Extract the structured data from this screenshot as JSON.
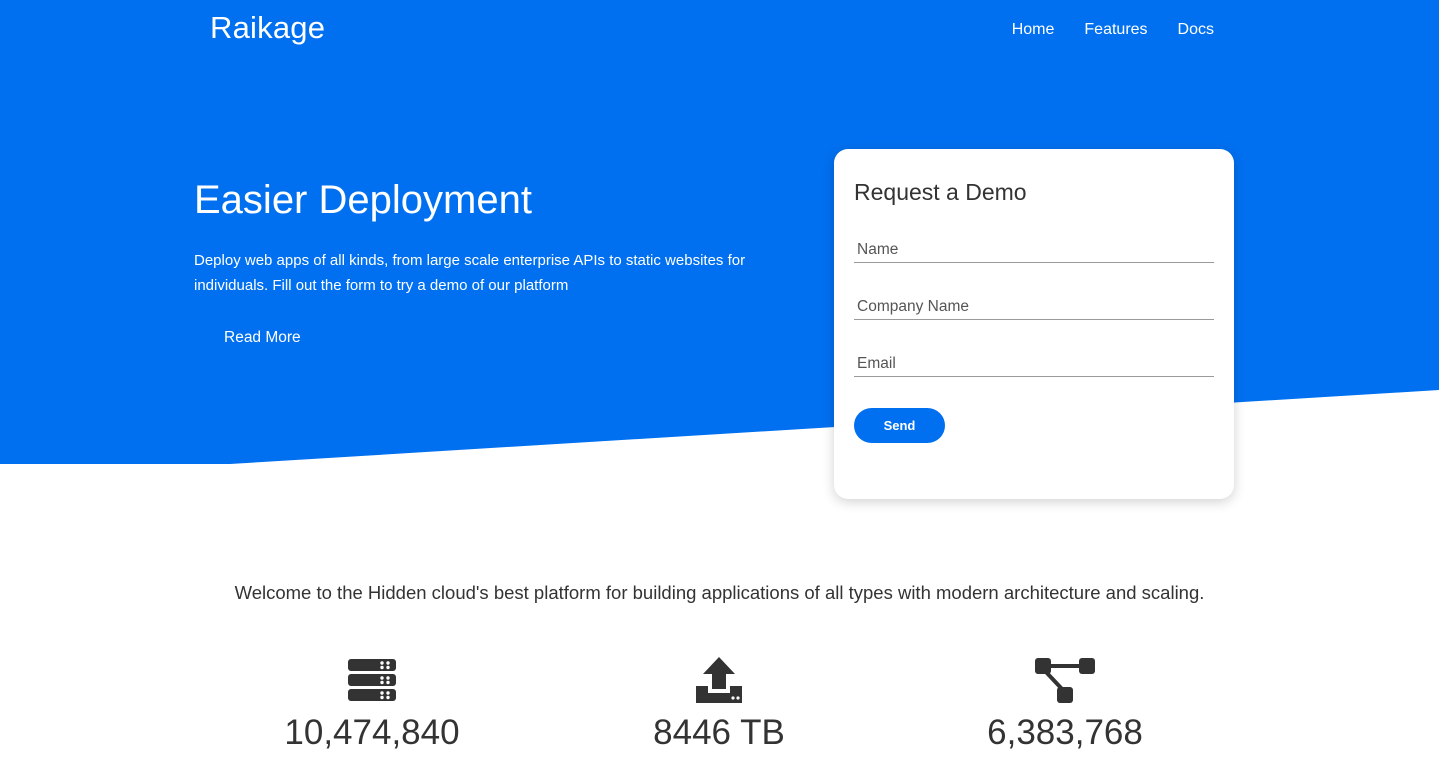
{
  "colors": {
    "primary": "#0070f0",
    "card": "#ffffff",
    "text": "#333333"
  },
  "nav": {
    "brand": "Raikage",
    "links": [
      {
        "label": "Home"
      },
      {
        "label": "Features"
      },
      {
        "label": "Docs"
      }
    ]
  },
  "hero": {
    "title": "Easier Deployment",
    "description": "Deploy web apps of all kinds, from large scale enterprise APIs to static websites for individuals. Fill out the form to try a demo of our platform",
    "read_more": "Read More"
  },
  "demo_form": {
    "title": "Request a Demo",
    "name_placeholder": "Name",
    "company_placeholder": "Company Name",
    "email_placeholder": "Email",
    "send_label": "Send"
  },
  "welcome": "Welcome to the Hidden cloud's best platform for building applications of all types with modern architecture and scaling.",
  "stats": [
    {
      "icon": "server-icon",
      "value": "10,474,840"
    },
    {
      "icon": "upload-icon",
      "value": "8446 TB"
    },
    {
      "icon": "network-icon",
      "value": "6,383,768"
    }
  ]
}
